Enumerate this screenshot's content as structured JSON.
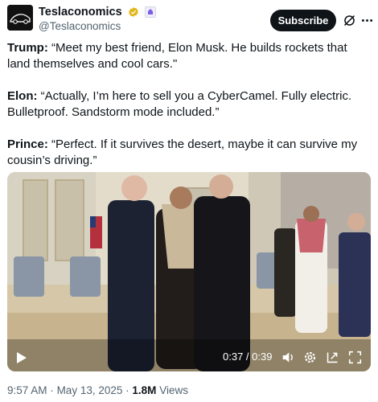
{
  "account": {
    "display_name": "Teslaconomics",
    "handle": "@Teslaconomics",
    "subscribe_label": "Subscribe"
  },
  "tweet": {
    "paragraphs": [
      {
        "speaker": "Trump:",
        "text": " “Meet my best friend, Elon Musk. He builds rockets that land themselves and cool cars.\""
      },
      {
        "speaker": "Elon:",
        "text": " “Actually, I’m here to sell you a CyberCamel. Fully electric. Bulletproof. Sandstorm mode included.”"
      },
      {
        "speaker": "Prince:",
        "text": " “Perfect. If it survives the desert, maybe it can survive my cousin’s driving.”"
      }
    ]
  },
  "video": {
    "timecode": "0:37 / 0:39",
    "progress": 0.949
  },
  "meta": {
    "time": "9:57 AM",
    "separator": "·",
    "date": "May 13, 2025",
    "views_count": "1.8M",
    "views_label": "Views"
  },
  "colors": {
    "text": "#0f1419",
    "secondary": "#536471",
    "verified": "#e2b719",
    "button": "#0f1419"
  },
  "icons": [
    "car-logo-icon",
    "verified-badge-icon",
    "affiliate-badge-icon",
    "grok-icon",
    "more-icon",
    "play-icon",
    "volume-icon",
    "settings-icon",
    "pip-icon",
    "fullscreen-icon"
  ]
}
